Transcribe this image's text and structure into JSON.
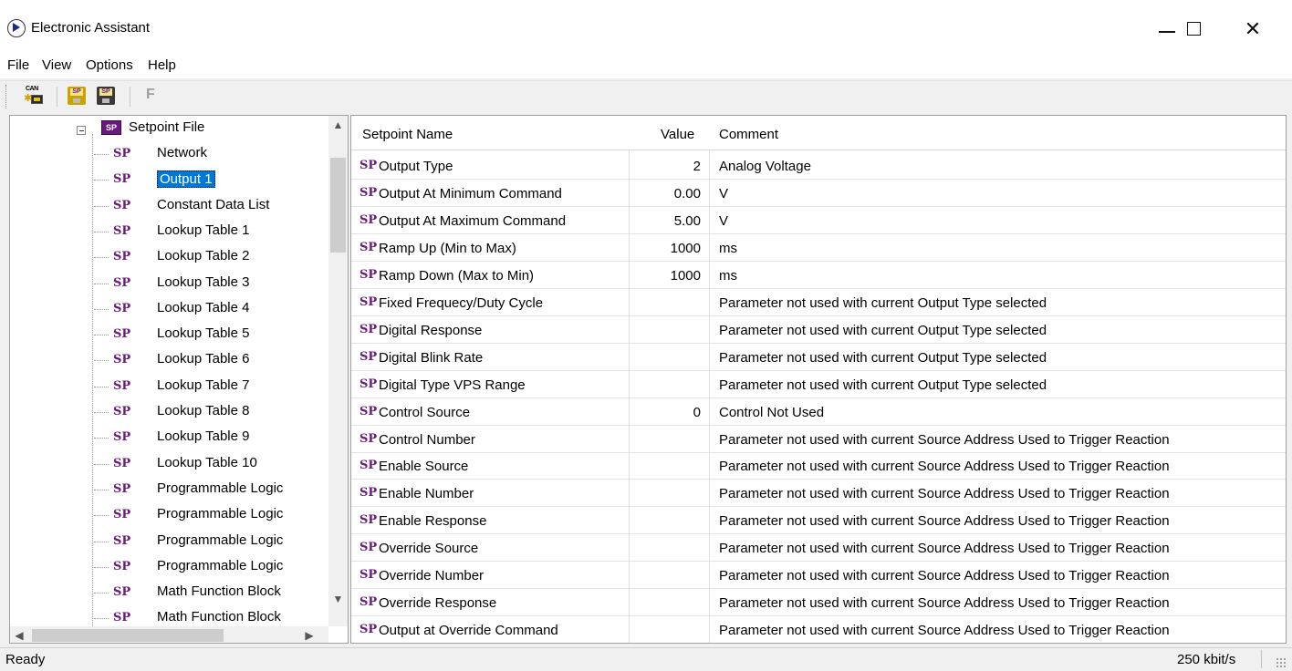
{
  "window": {
    "title": "Electronic Assistant"
  },
  "menu": [
    "File",
    "View",
    "Options",
    "Help"
  ],
  "toolbar": {
    "can_label": "CAN",
    "sp_label": "SP",
    "f_label": "F"
  },
  "tree": {
    "root_icon": "SP",
    "root_label": "Setpoint File",
    "item_icon": "SP",
    "selected": "Output 1",
    "items": [
      "Network",
      "Output 1",
      "Constant Data List",
      "Lookup Table 1",
      "Lookup Table 2",
      "Lookup Table 3",
      "Lookup Table 4",
      "Lookup Table 5",
      "Lookup Table 6",
      "Lookup Table 7",
      "Lookup Table 8",
      "Lookup Table 9",
      "Lookup Table 10",
      "Programmable Logic",
      "Programmable Logic",
      "Programmable Logic",
      "Programmable Logic",
      "Math Function Block",
      "Math Function Block"
    ]
  },
  "grid": {
    "headers": {
      "name": "Setpoint Name",
      "value": "Value",
      "comment": "Comment"
    },
    "row_icon": "SP",
    "rows": [
      {
        "name": "Output Type",
        "value": "2",
        "comment": "Analog Voltage"
      },
      {
        "name": "Output At Minimum Command",
        "value": "0.00",
        "comment": "V"
      },
      {
        "name": "Output At Maximum Command",
        "value": "5.00",
        "comment": "V"
      },
      {
        "name": "Ramp Up (Min to Max)",
        "value": "1000",
        "comment": "ms"
      },
      {
        "name": "Ramp Down (Max to Min)",
        "value": "1000",
        "comment": "ms"
      },
      {
        "name": "Fixed Frequecy/Duty Cycle",
        "value": "",
        "comment": "Parameter not used with current Output Type selected"
      },
      {
        "name": "Digital Response",
        "value": "",
        "comment": "Parameter not used with current Output Type selected"
      },
      {
        "name": "Digital Blink Rate",
        "value": "",
        "comment": "Parameter not used with current Output Type selected"
      },
      {
        "name": "Digital Type VPS Range",
        "value": "",
        "comment": "Parameter not used with current Output Type selected"
      },
      {
        "name": "Control Source",
        "value": "0",
        "comment": "Control Not Used"
      },
      {
        "name": "Control Number",
        "value": "",
        "comment": "Parameter not used with current Source Address Used to Trigger Reaction"
      },
      {
        "name": "Enable Source",
        "value": "",
        "comment": "Parameter not used with current Source Address Used to Trigger Reaction"
      },
      {
        "name": "Enable Number",
        "value": "",
        "comment": "Parameter not used with current Source Address Used to Trigger Reaction"
      },
      {
        "name": "Enable Response",
        "value": "",
        "comment": "Parameter not used with current Source Address Used to Trigger Reaction"
      },
      {
        "name": "Override Source",
        "value": "",
        "comment": "Parameter not used with current Source Address Used to Trigger Reaction"
      },
      {
        "name": "Override Number",
        "value": "",
        "comment": "Parameter not used with current Source Address Used to Trigger Reaction"
      },
      {
        "name": "Override Response",
        "value": "",
        "comment": "Parameter not used with current Source Address Used to Trigger Reaction"
      },
      {
        "name": "Output at Override Command",
        "value": "",
        "comment": "Parameter not used with current Source Address Used to Trigger Reaction"
      }
    ]
  },
  "status": {
    "text": "Ready",
    "bitrate": "250 kbit/s"
  }
}
